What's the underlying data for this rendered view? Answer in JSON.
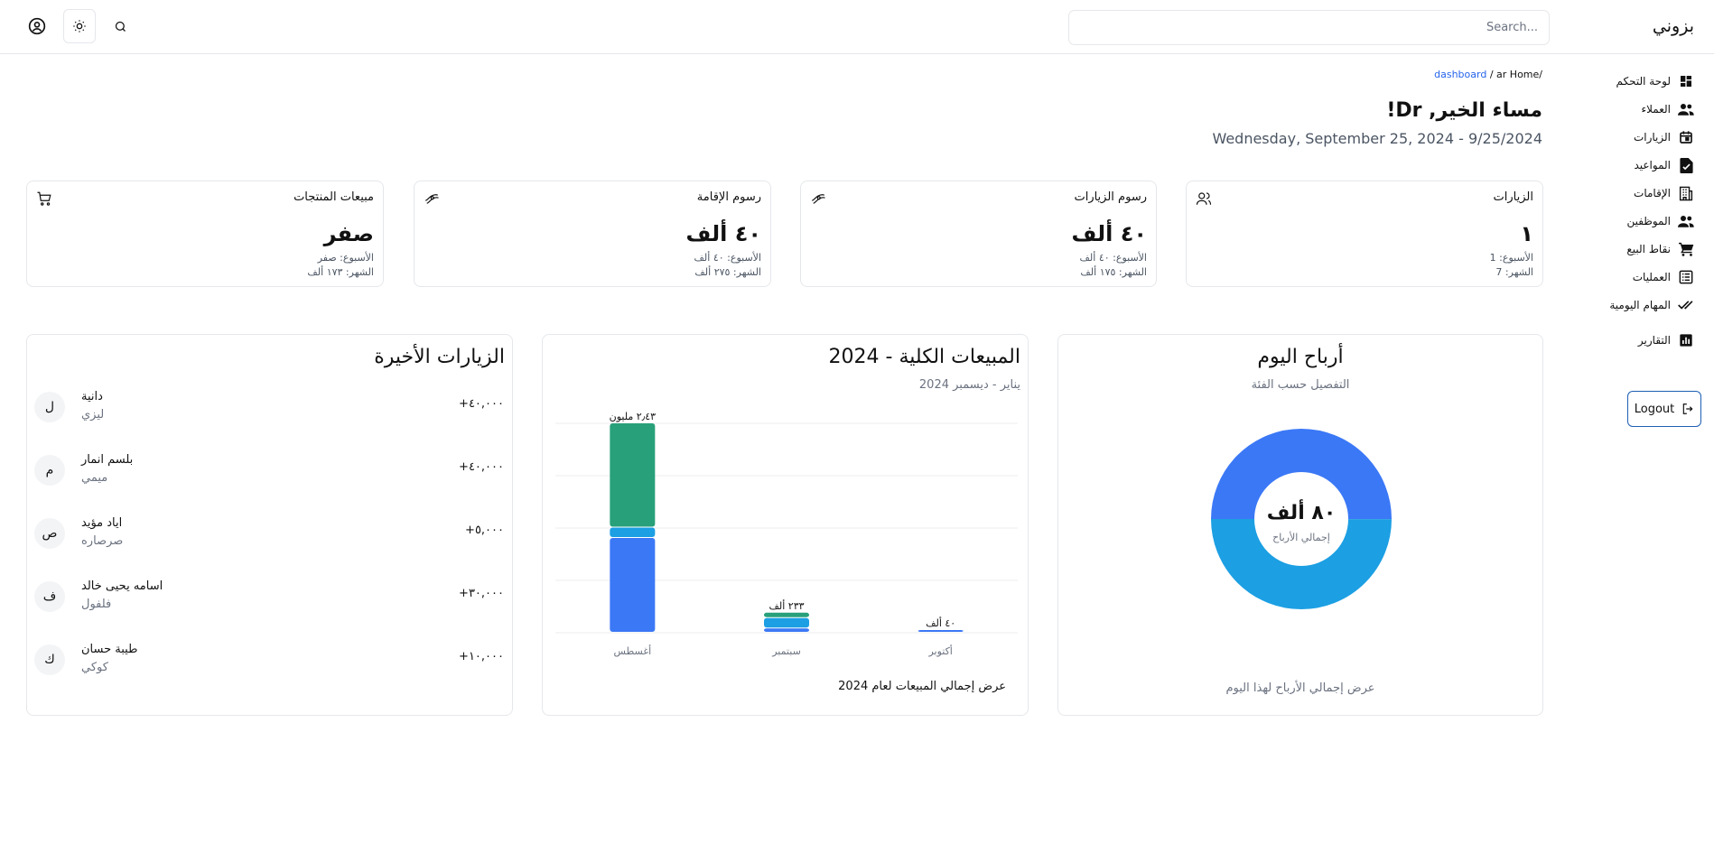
{
  "topbar": {
    "brand": "بزوني",
    "search_placeholder": "Search..."
  },
  "sidebar": {
    "items": [
      {
        "label": "لوحة التحكم",
        "icon": "dashboard-icon"
      },
      {
        "label": "العملاء",
        "icon": "people-icon"
      },
      {
        "label": "الزيارات",
        "icon": "calendar-icon"
      },
      {
        "label": "المواعيد",
        "icon": "document-check-icon"
      },
      {
        "label": "الإقامات",
        "icon": "hotel-icon"
      },
      {
        "label": "الموظفين",
        "icon": "staff-icon"
      },
      {
        "label": "نقاط البيع",
        "icon": "cart-icon"
      },
      {
        "label": "العمليات",
        "icon": "list-icon"
      },
      {
        "label": "المهام اليومية",
        "icon": "double-check-icon"
      },
      {
        "label": "التقارير",
        "icon": "report-icon"
      }
    ],
    "logout_label": "Logout"
  },
  "header": {
    "breadcrumb_home": "Home/",
    "breadcrumb_ar": "ar",
    "breadcrumb_sep": "/",
    "breadcrumb_dashboard": "dashboard",
    "greeting": "مساء الخير, Dr!",
    "date": "Wednesday, September 25, 2024 - 9/25/2024"
  },
  "stats": [
    {
      "title": "الزيارات",
      "value": "١",
      "week": "الأسبوع: 1",
      "month": "الشهر: 7",
      "icon": "users-icon"
    },
    {
      "title": "رسوم الزيارات",
      "value": "٤٠ ألف",
      "week": "الأسبوع: ٤٠ ألف",
      "month": "الشهر: ١٧٥ ألف",
      "icon": "money-icon"
    },
    {
      "title": "رسوم الإقامة",
      "value": "٤٠ ألف",
      "week": "الأسبوع: ٤٠ ألف",
      "month": "الشهر: ٢٧٥ ألف",
      "icon": "money-icon"
    },
    {
      "title": "مبيعات المنتجات",
      "value": "صفر",
      "week": "الأسبوع: صفر",
      "month": "الشهر: ١٧٣ ألف",
      "icon": "cart-icon"
    }
  ],
  "profit": {
    "title": "أرباح اليوم",
    "subtitle": "التفصيل حسب الفئة",
    "center_value": "٨٠ ألف",
    "center_label": "إجمالي الأرباح",
    "footer": "عرض إجمالي الأرباح لهذا اليوم",
    "segments": [
      {
        "value": 50,
        "color": "#3b78f6"
      },
      {
        "value": 50,
        "color": "#1c9fe3"
      }
    ]
  },
  "sales": {
    "title": "المبيعات الكلية - 2024",
    "subtitle": "يناير - ديسمبر 2024",
    "footer": "عرض إجمالي المبيعات لعام 2024"
  },
  "chart_data": {
    "type": "bar",
    "stacked": true,
    "categories": [
      "أغسطس",
      "سبتمبر",
      "أكتوبر"
    ],
    "series": [
      {
        "values": [
          1100000,
          50000,
          20000
        ],
        "color": "#3b78f6"
      },
      {
        "values": [
          120000,
          120000,
          0
        ],
        "color": "#1c9fe3"
      },
      {
        "values": [
          1210000,
          63000,
          0
        ],
        "color": "#28a07a"
      }
    ],
    "totals": [
      "٢٫٤٣ مليون",
      "٢٣٣ ألف",
      "٤٠ ألف"
    ],
    "ylim": [
      0,
      2430000
    ],
    "grid": true
  },
  "visits": {
    "title": "الزيارات الأخيرة",
    "rows": [
      {
        "initial": "ل",
        "name": "دانية",
        "pet": "ليزي",
        "amount": "+٤٠,٠٠٠"
      },
      {
        "initial": "م",
        "name": "بلسم انمار",
        "pet": "ميمي",
        "amount": "+٤٠,٠٠٠"
      },
      {
        "initial": "ص",
        "name": "اياد مؤيد",
        "pet": "صرصاره",
        "amount": "+٥,٠٠٠"
      },
      {
        "initial": "ف",
        "name": "اسامه يحيى خالد",
        "pet": "فلفول",
        "amount": "+٣٠,٠٠٠"
      },
      {
        "initial": "ك",
        "name": "طيبة حسان",
        "pet": "كوكي",
        "amount": "+١٠,٠٠٠"
      }
    ]
  }
}
